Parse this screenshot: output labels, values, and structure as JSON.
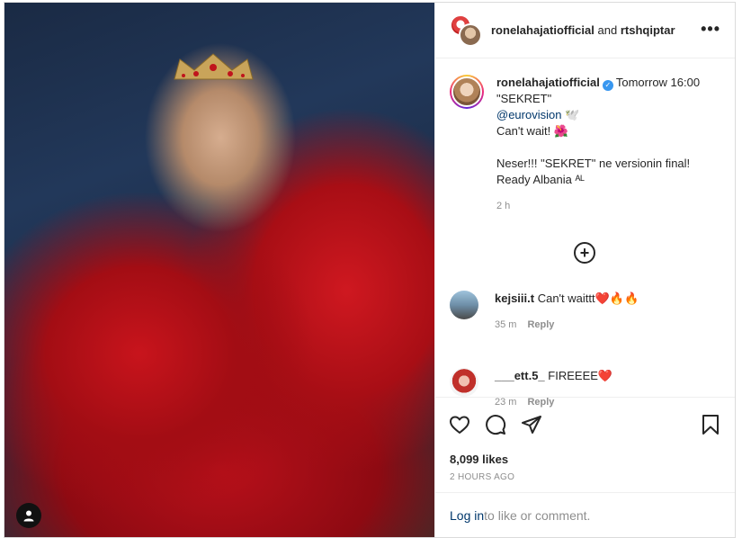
{
  "header": {
    "user1": "ronelahajatiofficial",
    "joiner": "and",
    "user2": "rtshqiptar",
    "more_label": "•••"
  },
  "caption": {
    "username": "ronelahajatiofficial",
    "line1_rest": "Tomorrow 16:00",
    "line2": "\"SEKRET\"",
    "mention": "@eurovision",
    "line3": "Can't wait! 🌺",
    "line4": "Neser!!! \"SEKRET\" ne versionin final!",
    "line5": "Ready Albania ᴬᴸ",
    "time": "2 h"
  },
  "comments": [
    {
      "username": "kejsiii.t",
      "text": "Can't waittt❤️🔥🔥",
      "time": "35 m",
      "reply": "Reply"
    },
    {
      "username": "___ett.5_",
      "text": "FIREEEE❤️",
      "time": "23 m",
      "reply": "Reply"
    }
  ],
  "likes": "8,099 likes",
  "posted_ago": "2 HOURS AGO",
  "login": {
    "link": "Log in",
    "rest": " to like or comment."
  },
  "icons": [
    "heart-icon",
    "comment-icon",
    "share-icon",
    "bookmark-icon",
    "add-circle-icon",
    "user-tag-icon",
    "more-icon"
  ]
}
